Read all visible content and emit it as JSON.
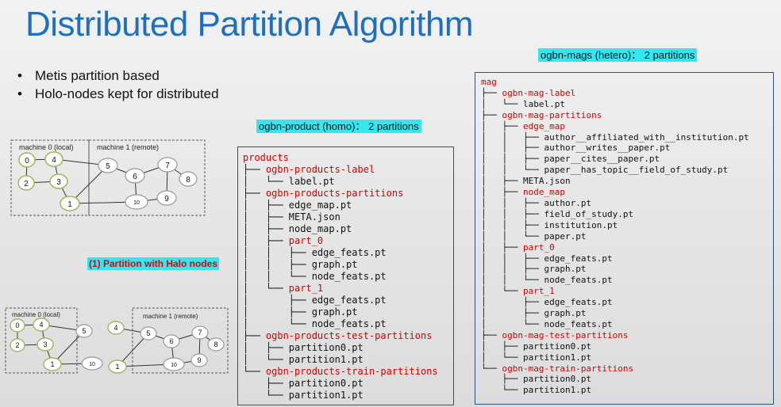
{
  "title": "Distributed Partition Algorithm",
  "bullets": [
    "Metis partition based",
    "Holo-nodes kept for distributed"
  ],
  "labels": {
    "mag_tag": "ogbn-mags (hetero)： 2 partitions",
    "product_tag": "ogbn-product (homo)： 2 partitions",
    "arrow_label": "(1) Partition with Halo nodes",
    "machine0_top": "machine 0 (local)",
    "machine1_top": "machine 1 (remote)",
    "machine0_bottom": "machine 0 (local)",
    "machine1_bottom": "machine 1 (remote)"
  },
  "graph_top": {
    "nodes": [
      "0",
      "4",
      "2",
      "3",
      "1",
      "5",
      "6",
      "7",
      "8",
      "10",
      "9"
    ]
  },
  "graph_bottom": {
    "left_nodes": [
      "0",
      "4",
      "5",
      "2",
      "3",
      "1",
      "10"
    ],
    "right_nodes": [
      "4",
      "5",
      "7",
      "6",
      "8",
      "1",
      "10",
      "9"
    ]
  },
  "products_tree": [
    {
      "prefix": "",
      "name": "products",
      "red": true
    },
    {
      "prefix": "├── ",
      "name": "ogbn-products-label",
      "red": true
    },
    {
      "prefix": "│   └── ",
      "name": "label.pt",
      "red": false
    },
    {
      "prefix": "├── ",
      "name": "ogbn-products-partitions",
      "red": true
    },
    {
      "prefix": "│   ├── ",
      "name": "edge_map.pt",
      "red": false
    },
    {
      "prefix": "│   ├── ",
      "name": "META.json",
      "red": false
    },
    {
      "prefix": "│   ├── ",
      "name": "node_map.pt",
      "red": false
    },
    {
      "prefix": "│   ├── ",
      "name": "part_0",
      "red": true
    },
    {
      "prefix": "│   │   ├── ",
      "name": "edge_feats.pt",
      "red": false
    },
    {
      "prefix": "│   │   ├── ",
      "name": "graph.pt",
      "red": false
    },
    {
      "prefix": "│   │   └── ",
      "name": "node_feats.pt",
      "red": false
    },
    {
      "prefix": "│   └── ",
      "name": "part_1",
      "red": true
    },
    {
      "prefix": "│       ├── ",
      "name": "edge_feats.pt",
      "red": false
    },
    {
      "prefix": "│       ├── ",
      "name": "graph.pt",
      "red": false
    },
    {
      "prefix": "│       └── ",
      "name": "node_feats.pt",
      "red": false
    },
    {
      "prefix": "├── ",
      "name": "ogbn-products-test-partitions",
      "red": true
    },
    {
      "prefix": "│   ├── ",
      "name": "partition0.pt",
      "red": false
    },
    {
      "prefix": "│   └── ",
      "name": "partition1.pt",
      "red": false
    },
    {
      "prefix": "└── ",
      "name": "ogbn-products-train-partitions",
      "red": true
    },
    {
      "prefix": "    ├── ",
      "name": "partition0.pt",
      "red": false
    },
    {
      "prefix": "    └── ",
      "name": "partition1.pt",
      "red": false
    }
  ],
  "mag_tree": [
    {
      "prefix": "",
      "name": "mag",
      "red": true
    },
    {
      "prefix": "├── ",
      "name": "ogbn-mag-label",
      "red": true
    },
    {
      "prefix": "│   └── ",
      "name": "label.pt",
      "red": false
    },
    {
      "prefix": "├── ",
      "name": "ogbn-mag-partitions",
      "red": true
    },
    {
      "prefix": "│   ├── ",
      "name": "edge_map",
      "red": true
    },
    {
      "prefix": "│   │   ├── ",
      "name": "author__affiliated_with__institution.pt",
      "red": false
    },
    {
      "prefix": "│   │   ├── ",
      "name": "author__writes__paper.pt",
      "red": false
    },
    {
      "prefix": "│   │   ├── ",
      "name": "paper__cites__paper.pt",
      "red": false
    },
    {
      "prefix": "│   │   └── ",
      "name": "paper__has_topic__field_of_study.pt",
      "red": false
    },
    {
      "prefix": "│   ├── ",
      "name": "META.json",
      "red": false
    },
    {
      "prefix": "│   ├── ",
      "name": "node_map",
      "red": true
    },
    {
      "prefix": "│   │   ├── ",
      "name": "author.pt",
      "red": false
    },
    {
      "prefix": "│   │   ├── ",
      "name": "field_of_study.pt",
      "red": false
    },
    {
      "prefix": "│   │   ├── ",
      "name": "institution.pt",
      "red": false
    },
    {
      "prefix": "│   │   └── ",
      "name": "paper.pt",
      "red": false
    },
    {
      "prefix": "│   ├── ",
      "name": "part_0",
      "red": true
    },
    {
      "prefix": "│   │   ├── ",
      "name": "edge_feats.pt",
      "red": false
    },
    {
      "prefix": "│   │   ├── ",
      "name": "graph.pt",
      "red": false
    },
    {
      "prefix": "│   │   └── ",
      "name": "node_feats.pt",
      "red": false
    },
    {
      "prefix": "│   └── ",
      "name": "part_1",
      "red": true
    },
    {
      "prefix": "│       ├── ",
      "name": "edge_feats.pt",
      "red": false
    },
    {
      "prefix": "│       ├── ",
      "name": "graph.pt",
      "red": false
    },
    {
      "prefix": "│       └── ",
      "name": "node_feats.pt",
      "red": false
    },
    {
      "prefix": "├── ",
      "name": "ogbn-mag-test-partitions",
      "red": true
    },
    {
      "prefix": "│   ├── ",
      "name": "partition0.pt",
      "red": false
    },
    {
      "prefix": "│   └── ",
      "name": "partition1.pt",
      "red": false
    },
    {
      "prefix": "└── ",
      "name": "ogbn-mag-train-partitions",
      "red": true
    },
    {
      "prefix": "    ├── ",
      "name": "partition0.pt",
      "red": false
    },
    {
      "prefix": "    └── ",
      "name": "partition1.pt",
      "red": false
    }
  ],
  "colors": {
    "title": "#1f6fc0",
    "highlight": "#33e6f0",
    "tree_red": "#d00000",
    "arrow": "#1f6fc0"
  }
}
